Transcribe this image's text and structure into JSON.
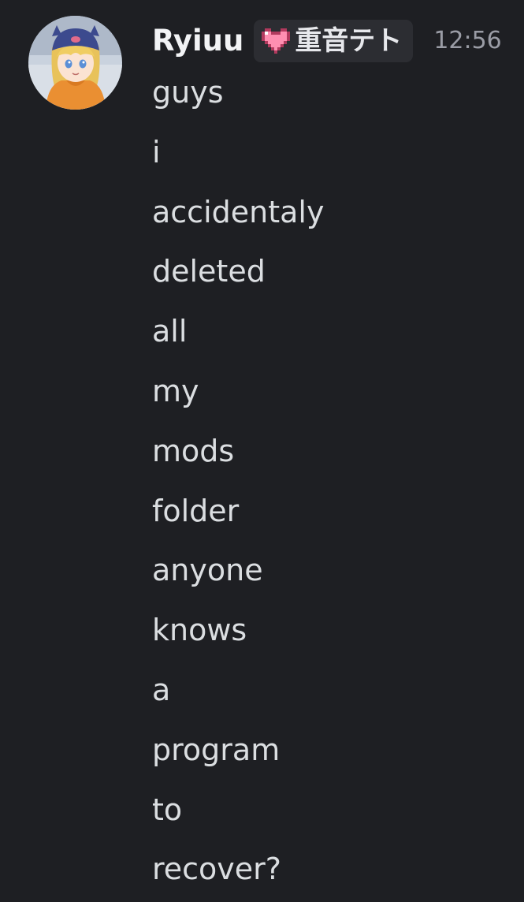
{
  "message": {
    "author": {
      "username": "Ryiuu",
      "avatar_icon": "avatar-anime-character-blue-cap-orange-hoodie"
    },
    "role_tag": {
      "icon": "pink-pixel-heart-icon",
      "label": "重音テト",
      "color": "#ff8fb1"
    },
    "timestamp": "12:56",
    "lines": [
      "guys",
      "i",
      "accidentaly",
      "deleted",
      "all",
      "my",
      "mods",
      "folder",
      "anyone",
      "knows",
      "a",
      "program",
      "to",
      "recover?"
    ]
  },
  "theme": {
    "background": "#1e1f23",
    "username_color": "#f2f3f5",
    "text_color": "#dbdee1",
    "timestamp_color": "#9a9ca5",
    "tag_background": "#2c2d32"
  }
}
